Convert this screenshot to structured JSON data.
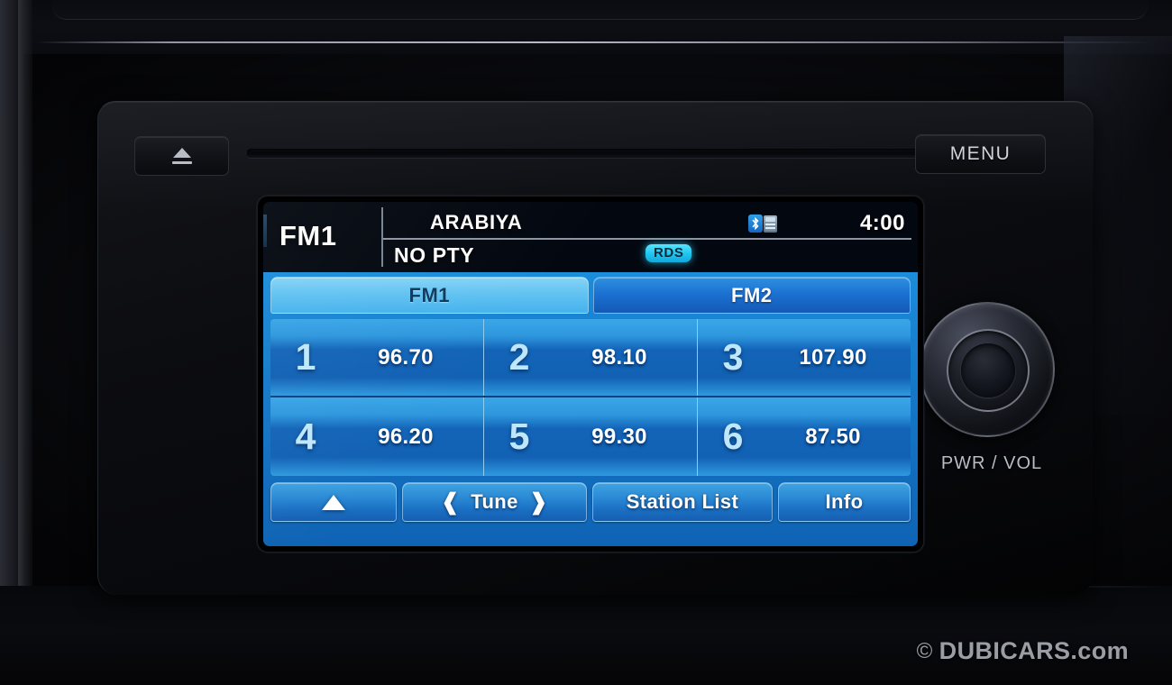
{
  "dashboard": {
    "watermark": {
      "copyright": "©",
      "text": "DUBICARS.com"
    }
  },
  "head_unit": {
    "eject_label": "eject-icon",
    "menu_button": "MENU",
    "knob_label": "PWR / VOL"
  },
  "screen": {
    "status": {
      "band": "FM1",
      "station_name": "ARABIYA",
      "pty": "NO PTY",
      "rds_badge": "RDS",
      "bluetooth_icon": "bluetooth-phone-icon",
      "clock": "4:00"
    },
    "tabs": [
      {
        "label": "FM1",
        "active": true
      },
      {
        "label": "FM2",
        "active": false
      }
    ],
    "presets": [
      {
        "number": "1",
        "frequency": "96.70"
      },
      {
        "number": "2",
        "frequency": "98.10"
      },
      {
        "number": "3",
        "frequency": "107.90"
      },
      {
        "number": "4",
        "frequency": "96.20"
      },
      {
        "number": "5",
        "frequency": "99.30"
      },
      {
        "number": "6",
        "frequency": "87.50"
      }
    ],
    "buttons": {
      "up": "",
      "tune": "Tune",
      "tune_prev": "❰",
      "tune_next": "❱",
      "station_list": "Station List",
      "info": "Info"
    },
    "colors": {
      "panel_blue": "#1479c9",
      "tab_active": "#62c3f2",
      "tab_inactive": "#1a6fd0",
      "rds_cyan": "#1fc4ef",
      "preset_number": "#bfe7fb",
      "status_bg": "#030810"
    }
  }
}
